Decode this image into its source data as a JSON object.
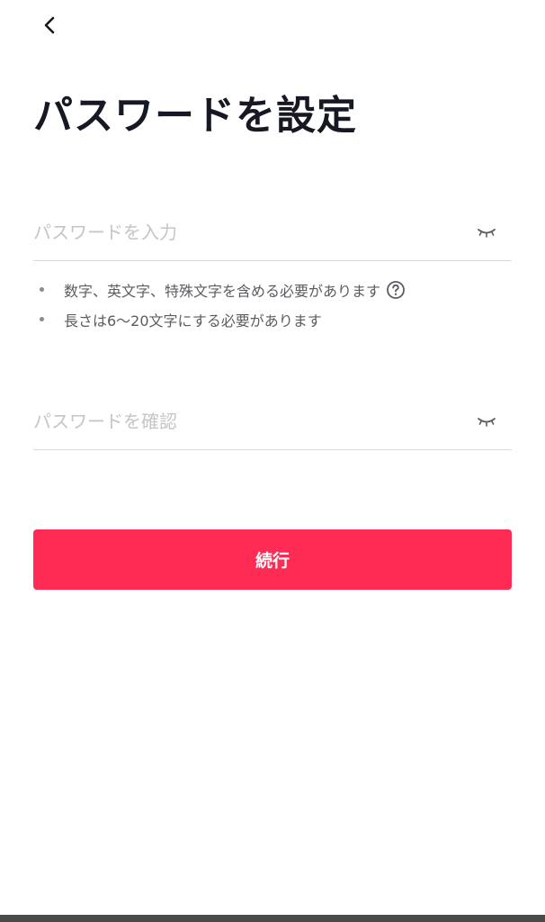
{
  "header": {
    "back_icon": "chevron-left-icon",
    "title": "パスワードを設定"
  },
  "password_field": {
    "value": "",
    "placeholder": "パスワードを入力",
    "toggle_icon": "eye-closed-icon"
  },
  "requirements": [
    {
      "text": "数字、英文字、特殊文字を含める必要があります",
      "icon": "question-circle-icon"
    },
    {
      "text": "長さは6〜20文字にする必要があります"
    }
  ],
  "confirm_field": {
    "value": "",
    "placeholder": "パスワードを確認",
    "toggle_icon": "eye-closed-icon"
  },
  "continue_button": {
    "label": "続行"
  },
  "colors": {
    "accent": "#fe2c55",
    "title_text": "#161823",
    "placeholder": "#c4c5c8",
    "helper_text": "#5b5c62",
    "divider": "#d9d9dc"
  }
}
